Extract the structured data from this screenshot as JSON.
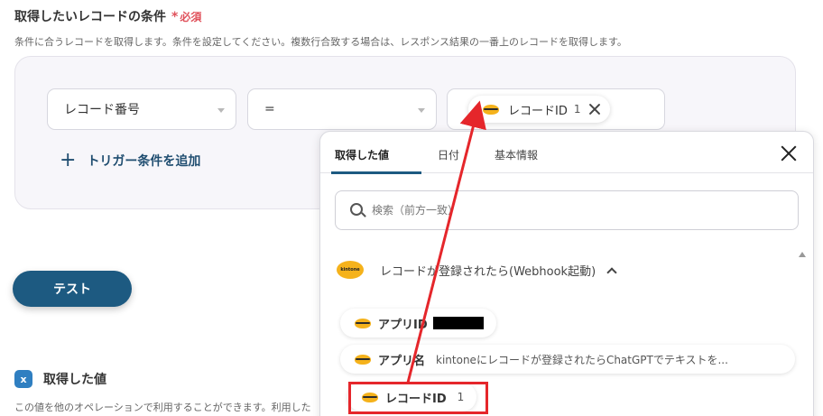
{
  "section": {
    "title": "取得したいレコードの条件",
    "required_label": "必須",
    "description": "条件に合うレコードを取得します。条件を設定してください。複数行合致する場合は、レスポンス結果の一番上のレコードを取得します。"
  },
  "condition": {
    "field": "レコード番号",
    "operator": "=",
    "value_chip": {
      "label": "レコードID",
      "value": "1"
    }
  },
  "add_trigger_label": "トリガー条件を追加",
  "test_button": "テスト",
  "acquired": {
    "icon": "x",
    "title": "取得した値",
    "description": "この値を他のオペレーションで利用することができます。利用した"
  },
  "panel": {
    "tabs": [
      "取得した値",
      "日付",
      "基本情報"
    ],
    "active_tab": 0,
    "search_placeholder": "検索（前方一致）",
    "source": {
      "logo_text": "kintone",
      "label": "レコードが登録されたら(Webhook起動)"
    },
    "items": [
      {
        "name": "アプリID",
        "value": ""
      },
      {
        "name": "アプリ名",
        "value": "kintoneにレコードが登録されたらChatGPTでテキストを..."
      },
      {
        "name": "レコードID",
        "value": "1"
      }
    ]
  },
  "colors": {
    "accent": "#1d5a81",
    "required": "#e0515b",
    "highlight": "#e5262b",
    "kintone": "#f5b21b"
  }
}
